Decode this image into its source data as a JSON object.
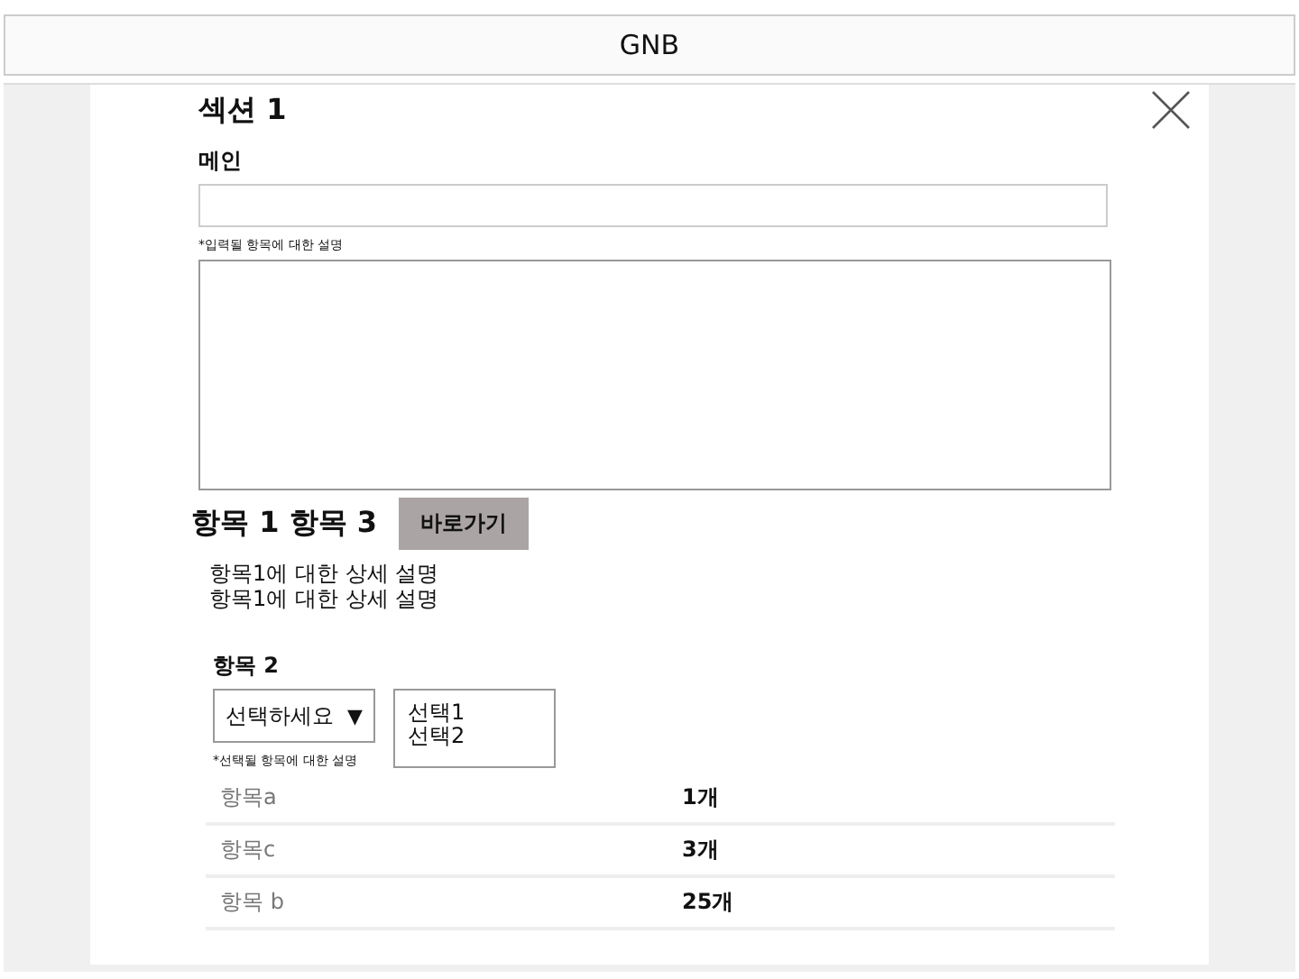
{
  "header": {
    "title": "GNB"
  },
  "section": {
    "title": "섹션 1",
    "main_label": "메인",
    "input_hint": "*입력될 항목에 대한 설명"
  },
  "item_heading": {
    "title": "항목 1 항목 3",
    "button": "바로가기"
  },
  "descriptions": [
    "항목1에 대한 상세 설명",
    "항목1에 대한 상세 설명"
  ],
  "select_group": {
    "label": "항목 2",
    "dropdown": "선택하세요",
    "arrow": "▼",
    "options": [
      "선택1",
      "선택2"
    ],
    "hint": "*선택될 항목에 대한 설명"
  },
  "rows": [
    {
      "name": "항목a",
      "count": "1개"
    },
    {
      "name": "항목c",
      "count": "3개"
    },
    {
      "name": "항목 b",
      "count": "25개"
    }
  ]
}
